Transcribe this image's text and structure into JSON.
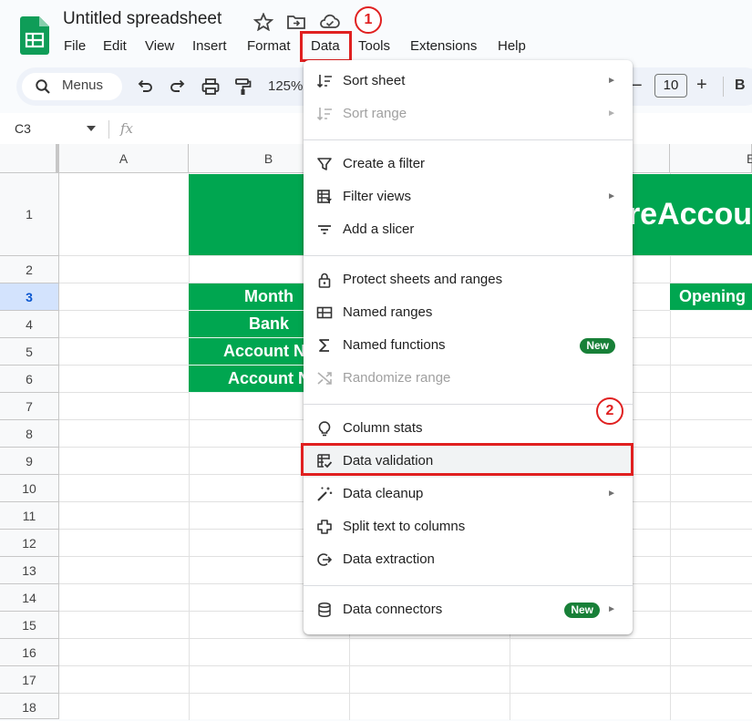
{
  "app": {
    "title": "Untitled spreadsheet"
  },
  "menubar": {
    "items": [
      "File",
      "Edit",
      "View",
      "Insert",
      "Format",
      "Data",
      "Tools",
      "Extensions",
      "Help"
    ],
    "active": "Data"
  },
  "toolbar": {
    "search_label": "Menus",
    "zoom": "125%",
    "font_size": "10",
    "minus": "−",
    "plus": "+",
    "bold": "B"
  },
  "formula_bar": {
    "cell_ref": "C3",
    "fx": "fx"
  },
  "grid": {
    "columns": [
      "A",
      "B",
      "E"
    ],
    "rows": [
      "1",
      "2",
      "3",
      "4",
      "5",
      "6",
      "7",
      "8",
      "9",
      "10",
      "11",
      "12",
      "13",
      "14",
      "15",
      "16",
      "17",
      "18"
    ],
    "cells": {
      "title_fragment": "reAccou",
      "b3": "Month",
      "b4": "Bank",
      "b5": "Account Na",
      "b6": "Account N",
      "e3": "Opening"
    }
  },
  "data_menu": {
    "items": [
      {
        "label": "Sort sheet",
        "icon": "sort-icon",
        "submenu": true
      },
      {
        "label": "Sort range",
        "icon": "sort-range-icon",
        "submenu": true,
        "disabled": true
      },
      {
        "label": "Create a filter",
        "icon": "filter-icon"
      },
      {
        "label": "Filter views",
        "icon": "filter-views-icon",
        "submenu": true
      },
      {
        "label": "Add a slicer",
        "icon": "slicer-icon"
      },
      {
        "label": "Protect sheets and ranges",
        "icon": "lock-icon"
      },
      {
        "label": "Named ranges",
        "icon": "named-ranges-icon"
      },
      {
        "label": "Named functions",
        "icon": "sigma-icon",
        "badge": "New"
      },
      {
        "label": "Randomize range",
        "icon": "shuffle-icon",
        "disabled": true
      },
      {
        "label": "Column stats",
        "icon": "lightbulb-icon"
      },
      {
        "label": "Data validation",
        "icon": "data-validation-icon",
        "highlighted": true
      },
      {
        "label": "Data cleanup",
        "icon": "magic-wand-icon",
        "submenu": true
      },
      {
        "label": "Split text to columns",
        "icon": "split-icon"
      },
      {
        "label": "Data extraction",
        "icon": "extraction-icon"
      },
      {
        "label": "Data connectors",
        "icon": "database-icon",
        "badge": "New",
        "submenu": true
      }
    ]
  },
  "annotations": {
    "step1": "1",
    "step2": "2"
  },
  "colors": {
    "green": "#00a650",
    "callout_red": "#e02020",
    "badge_green": "#188038"
  }
}
